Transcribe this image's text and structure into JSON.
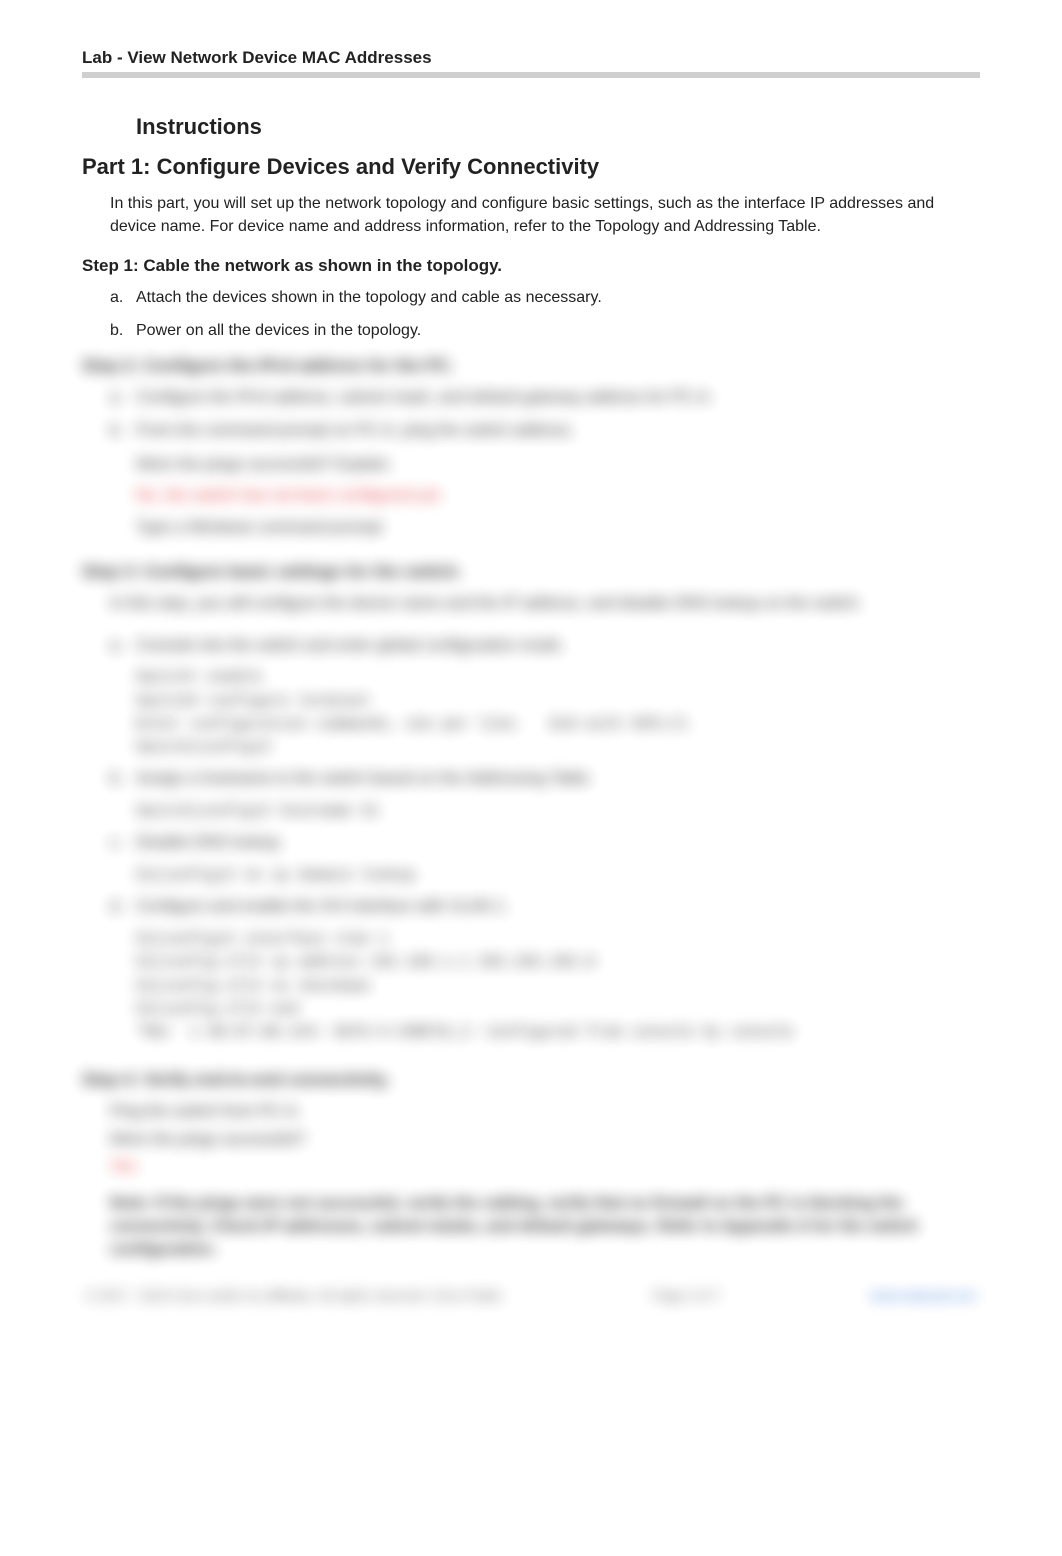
{
  "header": {
    "title": "Lab - View Network Device MAC Addresses"
  },
  "instructions_heading": "Instructions",
  "part1": {
    "heading": "Part 1: Configure Devices and Verify Connectivity",
    "intro": "In this part, you will set up the network topology and configure basic settings, such as the interface IP addresses and device name. For device name and address information, refer to the Topology and Addressing Table."
  },
  "step1": {
    "heading": "Step 1: Cable the network as shown in the topology.",
    "items": [
      {
        "marker": "a.",
        "text": "Attach the devices shown in the topology and cable as necessary."
      },
      {
        "marker": "b.",
        "text": "Power on all the devices in the topology."
      }
    ]
  },
  "step2": {
    "heading": "Step 2: Configure the IPv4 address for the PC.",
    "items": [
      {
        "marker": "a.",
        "text": "Configure the IPv4 address, subnet mask, and default gateway address for PC-A."
      },
      {
        "marker": "b.",
        "text": "From the command prompt on PC-A, ping the switch address."
      }
    ],
    "question": "Were the pings successful? Explain.",
    "answer_red": "No, the switch has not been configured yet.",
    "hint": "Type a Windows command prompt"
  },
  "step3": {
    "heading": "Step 3: Configure basic settings for the switch.",
    "intro": "In this step, you will configure the device name and the IP address, and disable DNS lookup on the switch.",
    "items": [
      {
        "marker": "a.",
        "text": "Console into the switch and enter global configuration mode."
      },
      {
        "marker": "b.",
        "text": "Assign a hostname to the switch based on the Addressing Table."
      },
      {
        "marker": "c.",
        "text": "Disable DNS lookup."
      },
      {
        "marker": "d.",
        "text": "Configure and enable the SVI interface with VLAN 1."
      }
    ],
    "code_a": "Switch> enable\nSwitch# configure terminal\nEnter configuration commands, one per line.   End with CNTL/Z.\nSwitch(config)#",
    "code_b": "Switch(config)# hostname S1",
    "code_c": "S1(config)# no ip domain-lookup",
    "code_d": "S1(config)# interface vlan 1\nS1(config-if)# ip address 192.168.1.1 255.255.255.0\nS1(config-if)# no shutdown\nS1(config-if)# end\n*Mar  1 00:07:00.244: %SYS-5-CONFIG_I: Configured from console by console"
  },
  "step4": {
    "heading": "Step 4: Verify end-to-end connectivity.",
    "line1": "Ping the switch from PC-A.",
    "line2": "Were the pings successful?",
    "answer_red": "Yes",
    "note": "Note: If the pings were not successful, verify the cabling, verify that no firewall on the PC is blocking the connectivity. Check IP addresses, subnet masks, and default gateways. Refer to Appendix A for the switch configuration."
  },
  "footer": {
    "left": "© 2017 - 2019 Cisco and/or its affiliates. All rights reserved. Cisco Public",
    "center": "Page 2 of 7",
    "right": "www.netacad.com"
  }
}
